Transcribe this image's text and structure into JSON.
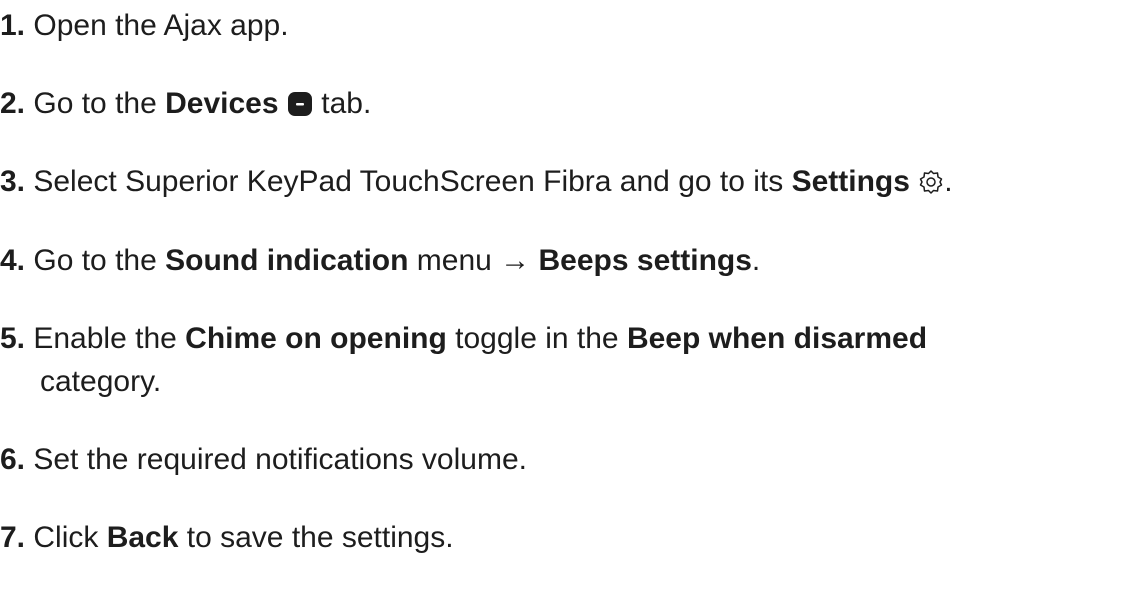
{
  "steps": [
    {
      "num": "1.",
      "pre": " Open the Ajax app."
    },
    {
      "num": "2.",
      "pre": " Go to the ",
      "bold": "Devices",
      "post": " tab.",
      "icon": "devices-tab-icon"
    },
    {
      "num": "3.",
      "pre": " Select Superior KeyPad TouchScreen Fibra and go to its ",
      "bold": "Settings",
      "post": ".",
      "icon": "gear-icon"
    },
    {
      "num": "4.",
      "pre": " Go to the ",
      "bold": "Sound indication",
      "mid": " menu → ",
      "bold2": "Beeps settings",
      "post": "."
    },
    {
      "num": "5.",
      "pre": " Enable the ",
      "bold": "Chime on opening",
      "mid": " toggle in the ",
      "bold2": "Beep when disarmed",
      "cont": "category."
    },
    {
      "num": "6.",
      "pre": " Set the required notifications volume."
    },
    {
      "num": "7.",
      "pre": " Click ",
      "bold": "Back",
      "post": " to save the settings."
    }
  ],
  "colors": {
    "text": "#1d1d1d",
    "icon": "#1d1d1d"
  }
}
